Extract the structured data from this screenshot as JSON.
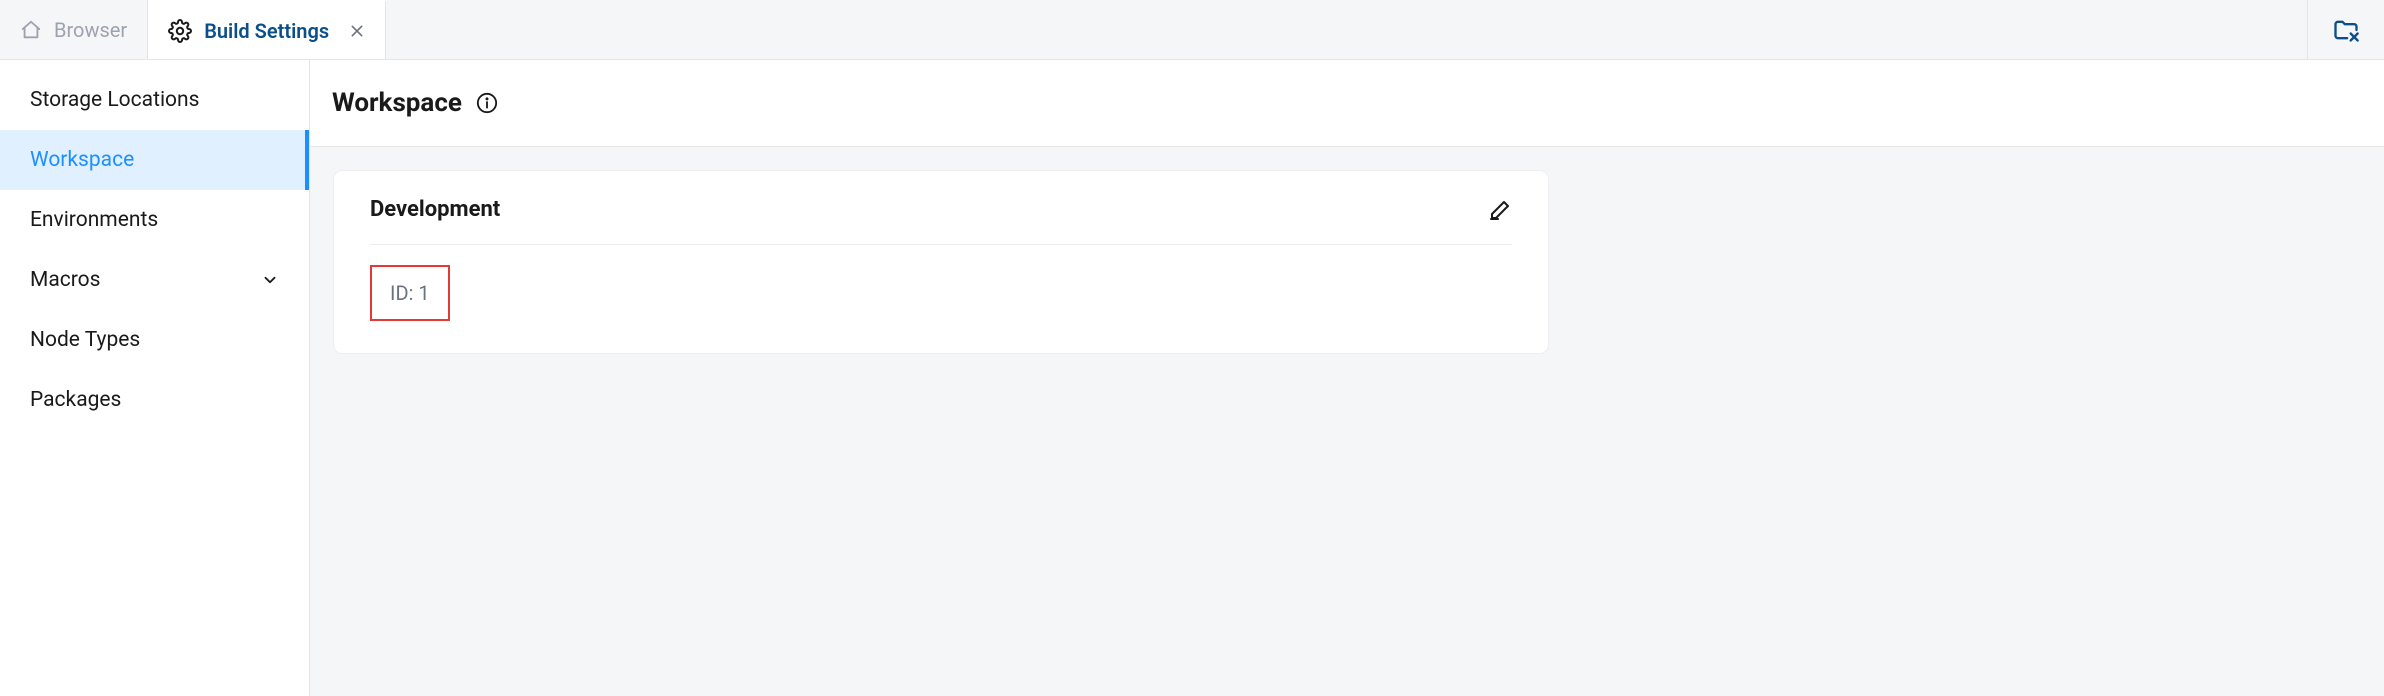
{
  "tabs": {
    "browser": {
      "label": "Browser"
    },
    "build_settings": {
      "label": "Build Settings"
    }
  },
  "sidebar": {
    "items": [
      {
        "label": "Storage Locations",
        "selected": false,
        "expandable": false
      },
      {
        "label": "Workspace",
        "selected": true,
        "expandable": false
      },
      {
        "label": "Environments",
        "selected": false,
        "expandable": false
      },
      {
        "label": "Macros",
        "selected": false,
        "expandable": true
      },
      {
        "label": "Node Types",
        "selected": false,
        "expandable": false
      },
      {
        "label": "Packages",
        "selected": false,
        "expandable": false
      }
    ]
  },
  "page": {
    "title": "Workspace"
  },
  "card": {
    "title": "Development",
    "id_label": "ID: 1"
  }
}
